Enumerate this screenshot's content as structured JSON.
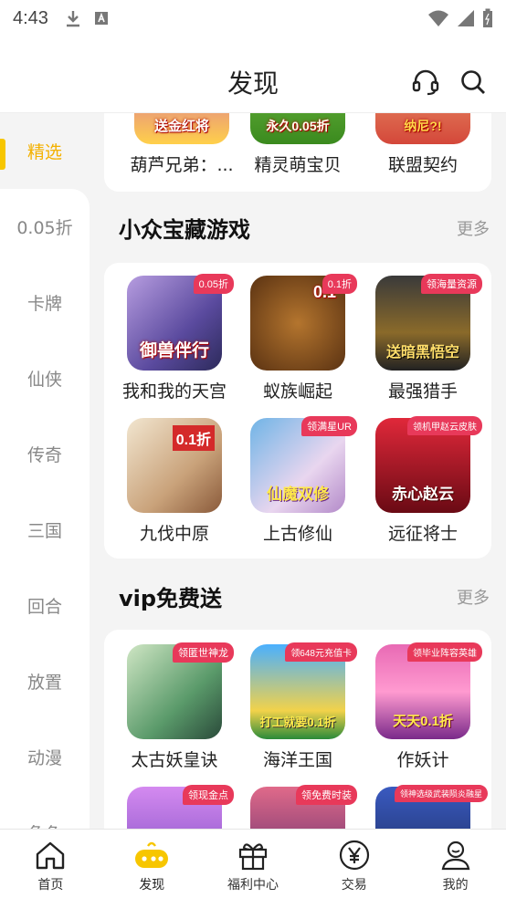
{
  "status_bar": {
    "time": "4:43"
  },
  "header": {
    "title": "发现",
    "support_icon": "headset-icon",
    "search_icon": "search-icon"
  },
  "sidebar": {
    "items": [
      {
        "label": "精选",
        "active": true
      },
      {
        "label": "0.05折"
      },
      {
        "label": "卡牌"
      },
      {
        "label": "仙侠"
      },
      {
        "label": "传奇"
      },
      {
        "label": "三国"
      },
      {
        "label": "回合"
      },
      {
        "label": "放置"
      },
      {
        "label": "动漫"
      },
      {
        "label": "角色"
      }
    ]
  },
  "top_row": {
    "games": [
      {
        "name": "葫芦兄弟：...",
        "icon_text": "送金红将"
      },
      {
        "name": "精灵萌宝贝",
        "icon_text": "永久0.05折"
      },
      {
        "name": "联盟契约",
        "icon_text": "纳尼?!"
      }
    ]
  },
  "section_hidden_gems": {
    "title": "小众宝藏游戏",
    "more": "更多",
    "games": [
      {
        "name": "我和我的天宫",
        "badge": "0.05折",
        "icon_text": "御兽伴行"
      },
      {
        "name": "蚁族崛起",
        "badge": "0.1折",
        "icon_text": "0.1"
      },
      {
        "name": "最强猎手",
        "badge": "领海量资源",
        "icon_text": "送暗黑悟空"
      },
      {
        "name": "九伐中原",
        "badge": "",
        "icon_text": "0.1折"
      },
      {
        "name": "上古修仙",
        "badge": "领满星UR",
        "icon_text": "仙魔双修"
      },
      {
        "name": "远征将士",
        "badge": "领机甲赵云皮肤",
        "icon_text": "赤心赵云"
      }
    ]
  },
  "section_vip": {
    "title": "vip免费送",
    "more": "更多",
    "games": [
      {
        "name": "太古妖皇诀",
        "badge": "领匿世神龙",
        "icon_text": ""
      },
      {
        "name": "海洋王国",
        "badge": "领648元充值卡",
        "icon_text": "打工就要0.1折"
      },
      {
        "name": "作妖计",
        "badge": "领毕业阵容英雄",
        "icon_text": "天天0.1折"
      },
      {
        "name": "",
        "badge": "领现金点",
        "icon_text": ""
      },
      {
        "name": "",
        "badge": "领免费时装",
        "icon_text": ""
      },
      {
        "name": "",
        "badge": "领神选级武装陨炎融星",
        "icon_text": ""
      }
    ]
  },
  "tabbar": {
    "items": [
      {
        "label": "首页",
        "icon": "home-icon"
      },
      {
        "label": "发现",
        "icon": "gamepad-icon",
        "active": true
      },
      {
        "label": "福利中心",
        "icon": "gift-icon"
      },
      {
        "label": "交易",
        "icon": "yen-icon"
      },
      {
        "label": "我的",
        "icon": "profile-icon"
      }
    ]
  }
}
